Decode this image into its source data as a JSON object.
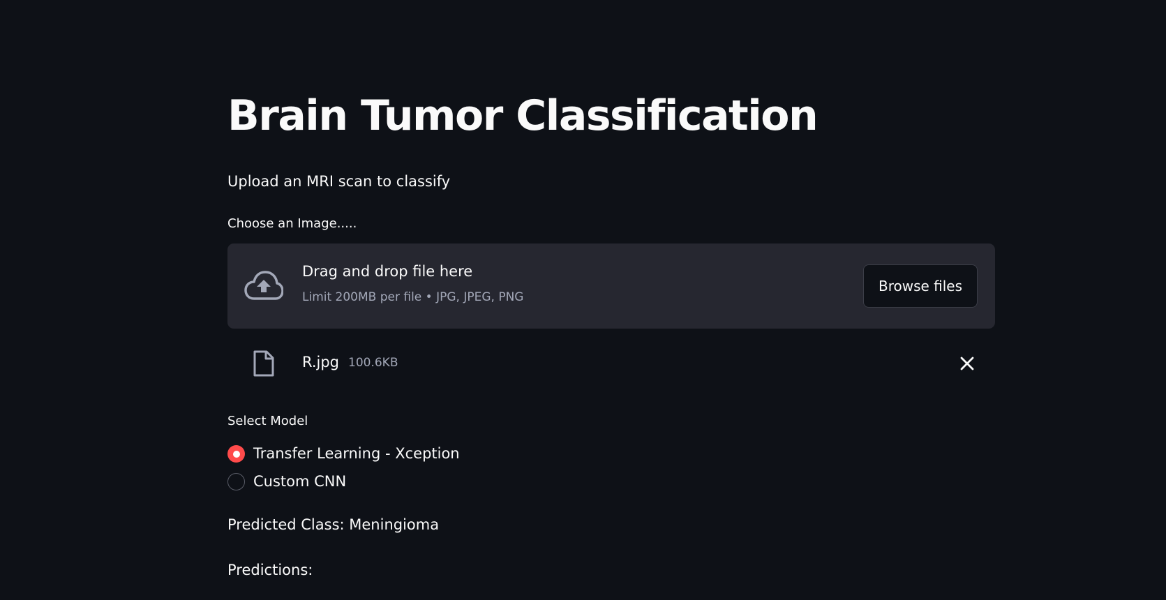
{
  "app": {
    "title": "Brain Tumor Classification",
    "subtitle": "Upload an MRI scan to classify"
  },
  "uploader": {
    "label": "Choose an Image.....",
    "dropzone_primary": "Drag and drop file here",
    "dropzone_secondary": "Limit 200MB per file • JPG, JPEG, PNG",
    "browse_label": "Browse files",
    "upload_icon": "cloud-upload-icon"
  },
  "uploaded_file": {
    "icon": "file-icon",
    "name": "R.jpg",
    "size": "100.6KB",
    "remove_icon": "close-icon"
  },
  "model_select": {
    "label": "Select Model",
    "options": [
      {
        "label": "Transfer Learning - Xception",
        "selected": true
      },
      {
        "label": "Custom CNN",
        "selected": false
      }
    ]
  },
  "results": {
    "predicted_class": "Predicted Class: Meningioma",
    "predictions_header": "Predictions:"
  },
  "colors": {
    "background": "#0e1117",
    "surface": "#262730",
    "accent": "#ff4b4b",
    "text": "#fafafa",
    "muted_text": "#a3a8b8"
  }
}
